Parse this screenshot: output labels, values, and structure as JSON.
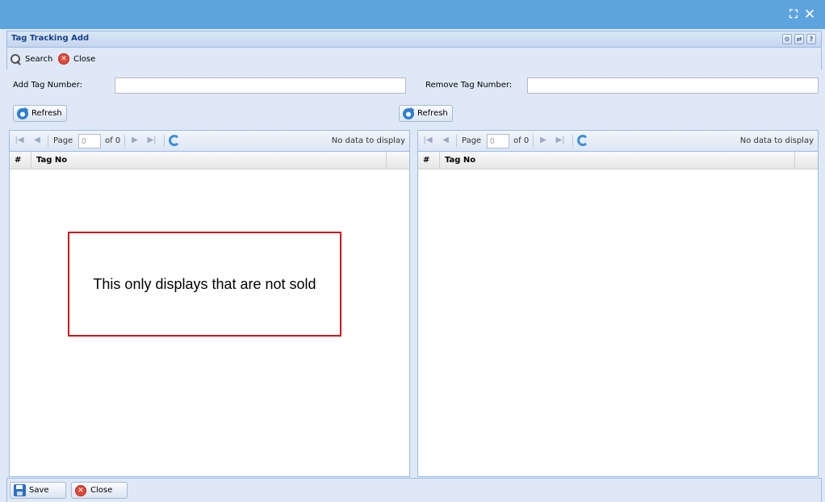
{
  "window": {
    "maximize_glyph": "⛶",
    "close_glyph": "✕"
  },
  "panel": {
    "title": "Tag Tracking Add",
    "tools": [
      {
        "name": "gear-icon",
        "glyph": "⚙"
      },
      {
        "name": "refresh-icon",
        "glyph": "⇄"
      },
      {
        "name": "help-icon",
        "glyph": "?"
      }
    ]
  },
  "toolbar": {
    "search_label": "Search",
    "close_label": "Close"
  },
  "form": {
    "add_label": "Add Tag Number:",
    "add_value": "",
    "remove_label": "Remove Tag Number:",
    "remove_value": ""
  },
  "refresh_label": "Refresh",
  "grids": [
    {
      "page_label": "Page",
      "page_value": "0",
      "of_label": "of 0",
      "empty_message": "No data to display",
      "columns": [
        "#",
        "Tag No"
      ]
    },
    {
      "page_label": "Page",
      "page_value": "0",
      "of_label": "of 0",
      "empty_message": "No data to display",
      "columns": [
        "#",
        "Tag No"
      ]
    }
  ],
  "annotation": "This only displays that are not sold",
  "footer": {
    "save_label": "Save",
    "close_label": "Close"
  },
  "colors": {
    "titlebar": "#5da3dd",
    "panel_title": "#15428b",
    "annotation_border": "#c8161d"
  }
}
